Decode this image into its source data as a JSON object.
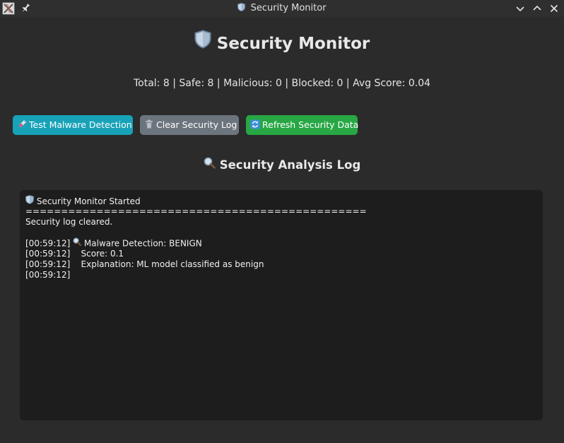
{
  "window": {
    "title": "Security Monitor",
    "title_icon": "shield-icon"
  },
  "header": {
    "title": "Security Monitor",
    "title_icon": "shield-icon"
  },
  "stats": {
    "text": "Total: 8 | Safe: 8 | Malicious: 0 | Blocked: 0 | Avg Score: 0.04"
  },
  "toolbar": {
    "test_label": "Test Malware Detection",
    "test_icon": "test-tube-icon",
    "clear_label": "Clear Security Log",
    "clear_icon": "trash-icon",
    "refresh_label": "Refresh Security Data",
    "refresh_icon": "refresh-icon"
  },
  "log_section": {
    "title": "Security Analysis Log",
    "title_icon": "magnifier-icon"
  },
  "log": {
    "lines": [
      "Security Monitor Started",
      "================================================",
      "Security log cleared.",
      "",
      "[00:59:12] ",
      "Malware Detection: BENIGN",
      "[00:59:12]    Score: 0.1",
      "[00:59:12]    Explanation: ML model classified as benign",
      "[00:59:12]"
    ]
  },
  "colors": {
    "background": "#2b2b2b",
    "log_background": "#1d1d1d",
    "test_button": "#17a2b8",
    "clear_button": "#6c757d",
    "refresh_button": "#28a745"
  }
}
